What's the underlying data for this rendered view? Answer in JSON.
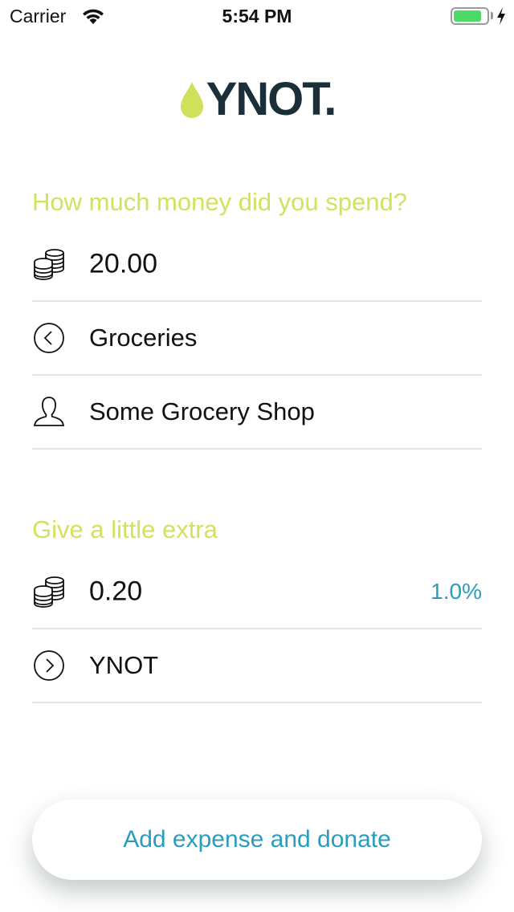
{
  "status_bar": {
    "carrier": "Carrier",
    "time": "5:54 PM",
    "battery_level": 0.85,
    "battery_color": "#4cd964"
  },
  "logo": {
    "text": "YNOT.",
    "drop_color": "#cfe05a",
    "text_color": "#1b2f3a"
  },
  "expense_section": {
    "title": "How much money did you spend?",
    "amount": "20.00",
    "category": "Groceries",
    "payee": "Some Grocery Shop",
    "icons": [
      "coins-icon",
      "chevron-left-circle-icon",
      "person-icon"
    ]
  },
  "extra_section": {
    "title": "Give a little extra",
    "amount": "0.20",
    "percent": "1.0%",
    "recipient": "YNOT",
    "icons": [
      "coins-icon",
      "chevron-right-circle-icon"
    ]
  },
  "cta": {
    "label": "Add expense and donate"
  },
  "colors": {
    "accent_green": "#d3e25c",
    "accent_blue": "#2a9dbf",
    "divider": "#e5e5e5"
  }
}
